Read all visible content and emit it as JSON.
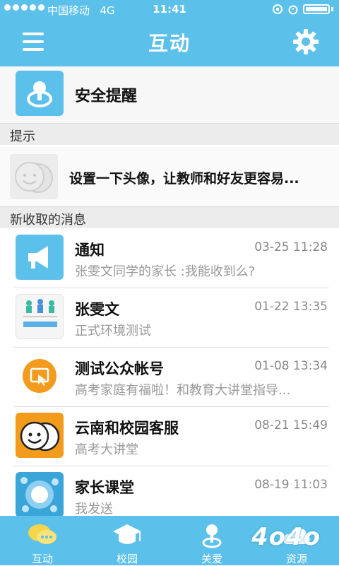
{
  "status_bar": {
    "carrier": "中国移动",
    "network": "4G",
    "time": "11:41"
  },
  "nav": {
    "title": "互动"
  },
  "safety": {
    "label": "安全提醒"
  },
  "sections": {
    "tips": "提示",
    "new_messages": "新收取的消息"
  },
  "tip": {
    "text": "设置一下头像，让教师和好友更容易..."
  },
  "messages": [
    {
      "name": "通知",
      "time": "03-25 11:28",
      "preview": "张雯文同学的家长 :我能收到么?"
    },
    {
      "name": "张雯文",
      "time": "01-22 13:35",
      "preview": "正式环境测试"
    },
    {
      "name": "测试公众帐号",
      "time": "01-08 13:34",
      "preview": "高考家庭有福啦！和教育大讲堂指导..."
    },
    {
      "name": "云南和校园客服",
      "time": "08-21 15:49",
      "preview": "高考大讲堂"
    },
    {
      "name": "家长课堂",
      "time": "08-19 11:03",
      "preview": "我发送"
    }
  ],
  "tabs": [
    {
      "label": "互动"
    },
    {
      "label": "校园"
    },
    {
      "label": "关爱"
    },
    {
      "label": "资源"
    }
  ],
  "watermark": "4o4o",
  "colors": {
    "brand": "#5bc0ea",
    "notice_orange": "#f29b1d"
  }
}
